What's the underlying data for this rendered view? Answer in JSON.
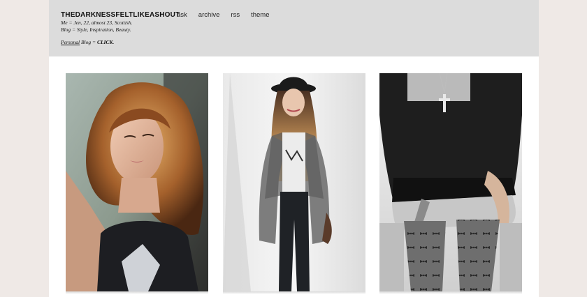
{
  "blog": {
    "title": "THEDARKNESSFELTLIKEASHOUT",
    "nav": [
      "ask",
      "archive",
      "rss",
      "theme"
    ],
    "description": {
      "line1": "Me = Jen, 22, almost 23, Scottish.",
      "line2": "Blog = Style, Inspiration, Beauty.",
      "personal_link": "Personal",
      "personal_mid": " Blog = ",
      "click_link": "CLICK",
      "personal_end": "."
    }
  },
  "posts": [
    {
      "alt_icon": "photo-woman-portrait"
    },
    {
      "alt_icon": "photo-woman-hat-cardigan"
    },
    {
      "alt_icon": "photo-sweater-cross-tights"
    }
  ],
  "colors": {
    "page_bg": "#efe9e6",
    "header_bg": "#dcdcdc",
    "content_bg": "#ffffff"
  }
}
